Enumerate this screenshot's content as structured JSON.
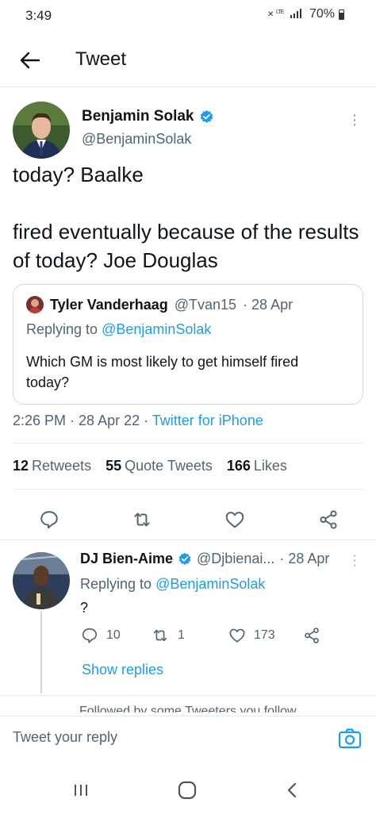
{
  "status_bar": {
    "time": "3:49",
    "network": "LTE",
    "battery": "70%"
  },
  "header": {
    "title": "Tweet",
    "back_icon": "arrow-left-icon"
  },
  "tweet": {
    "author_name": "Benjamin Solak",
    "author_handle": "@BenjaminSolak",
    "text": "today? Baalke\n\nfired eventually because of the results of today? Joe Douglas",
    "quote": {
      "author_name": "Tyler Vanderhaag",
      "author_handle": "@Tvan15",
      "date": "· 28 Apr",
      "replying_label": "Replying to",
      "replying_to": "@BenjaminSolak",
      "text": "Which GM is most likely to get himself fired today?"
    },
    "time": "2:26 PM",
    "date": "28 Apr 22",
    "source": "Twitter for iPhone",
    "stats": {
      "retweets_count": "12",
      "retweets_label": "Retweets",
      "quotes_count": "55",
      "quotes_label": "Quote Tweets",
      "likes_count": "166",
      "likes_label": "Likes"
    }
  },
  "reply": {
    "author_name": "DJ Bien-Aime",
    "author_handle": "@Djbienai...",
    "date": "· 28 Apr",
    "replying_label": "Replying to",
    "replying_to": "@BenjaminSolak",
    "text": "?",
    "reply_count": "10",
    "retweet_count": "1",
    "like_count": "173",
    "show_replies": "Show replies"
  },
  "followed_hint": "Followed by some Tweeters you follow",
  "compose": {
    "placeholder": "Tweet your reply"
  },
  "colors": {
    "accent": "#1d9bf0",
    "text": "#0f1419",
    "secondary": "#536471",
    "border": "#cfd9de"
  }
}
